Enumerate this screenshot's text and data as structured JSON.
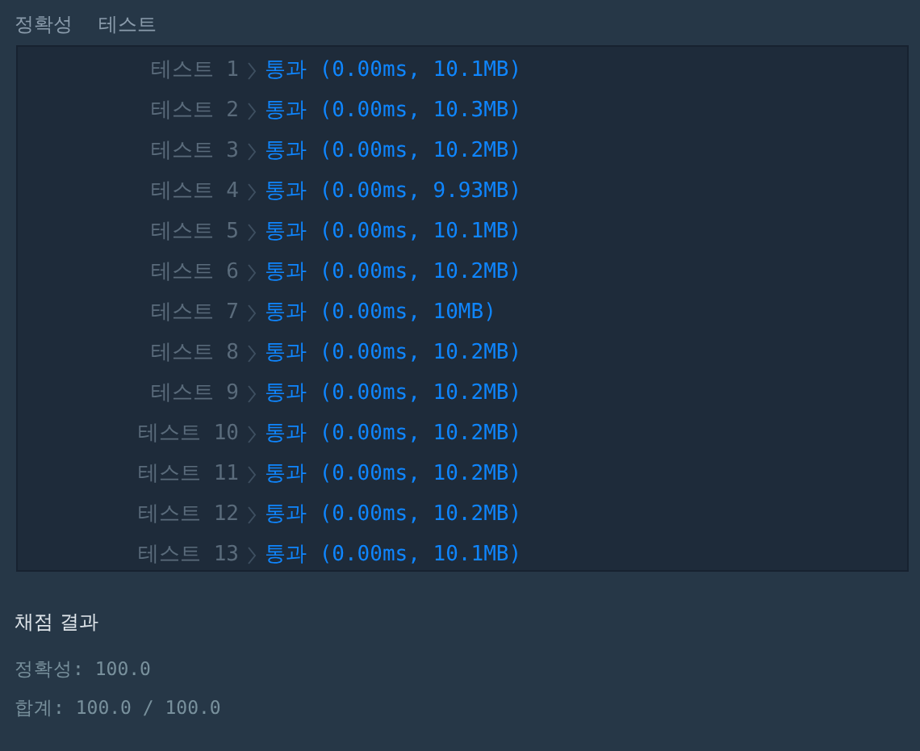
{
  "header": [
    "정확성",
    "테스트"
  ],
  "tests": [
    {
      "label": "테스트 1",
      "result": "통과 (0.00ms, 10.1MB)"
    },
    {
      "label": "테스트 2",
      "result": "통과 (0.00ms, 10.3MB)"
    },
    {
      "label": "테스트 3",
      "result": "통과 (0.00ms, 10.2MB)"
    },
    {
      "label": "테스트 4",
      "result": "통과 (0.00ms, 9.93MB)"
    },
    {
      "label": "테스트 5",
      "result": "통과 (0.00ms, 10.1MB)"
    },
    {
      "label": "테스트 6",
      "result": "통과 (0.00ms, 10.2MB)"
    },
    {
      "label": "테스트 7",
      "result": "통과 (0.00ms, 10MB)"
    },
    {
      "label": "테스트 8",
      "result": "통과 (0.00ms, 10.2MB)"
    },
    {
      "label": "테스트 9",
      "result": "통과 (0.00ms, 10.2MB)"
    },
    {
      "label": "테스트 10",
      "result": "통과 (0.00ms, 10.2MB)"
    },
    {
      "label": "테스트 11",
      "result": "통과 (0.00ms, 10.2MB)"
    },
    {
      "label": "테스트 12",
      "result": "통과 (0.00ms, 10.2MB)"
    },
    {
      "label": "테스트 13",
      "result": "통과 (0.00ms, 10.1MB)"
    }
  ],
  "summary": {
    "title": "채점 결과",
    "lines": [
      "정확성: 100.0",
      "합계: 100.0 / 100.0"
    ]
  }
}
